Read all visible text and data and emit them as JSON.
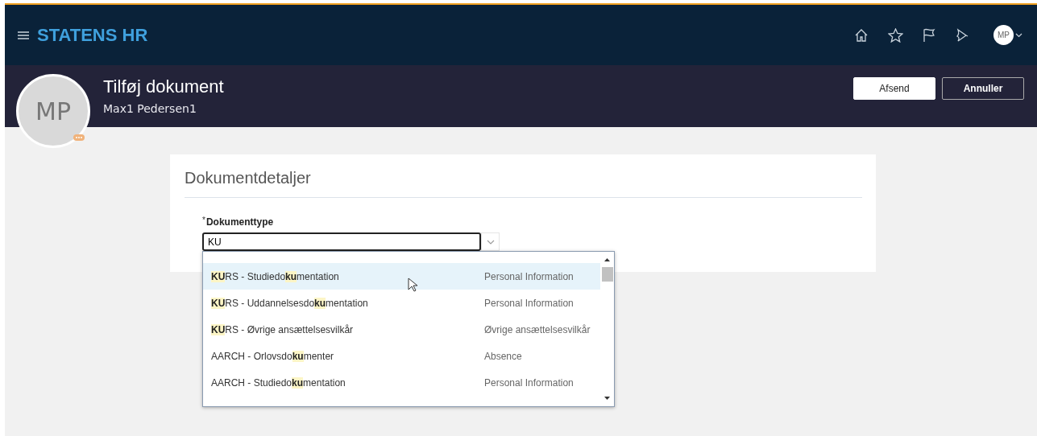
{
  "app": {
    "brand": "STATENS HR",
    "user_initials": "MP"
  },
  "page": {
    "title": "Tilføj dokument",
    "person": "Max1 Pedersen1",
    "avatar_initials": "MP",
    "buttons": [
      "Afsend",
      "Annuller"
    ]
  },
  "section": {
    "title": "Dokumentdetaljer",
    "field": {
      "label": "Dokumenttype",
      "required_mark": "*",
      "value": "KU"
    },
    "options": [
      {
        "name": "**KU**RS - Studiedo**ku**mentation",
        "category": "Personal Information",
        "selected": true
      },
      {
        "name": "**KU**RS - Uddannelsesdo**ku**mentation",
        "category": "Personal Information",
        "selected": false
      },
      {
        "name": "**KU**RS - Øvrige ansættelsesvilkår",
        "category": "Øvrige ansættelsesvilkår",
        "selected": false
      },
      {
        "name": "AARCH - Orlovsdo**ku**menter",
        "category": "Absence",
        "selected": false
      },
      {
        "name": "AARCH - Studiedo**ku**mentation",
        "category": "Personal Information",
        "selected": false
      }
    ]
  }
}
